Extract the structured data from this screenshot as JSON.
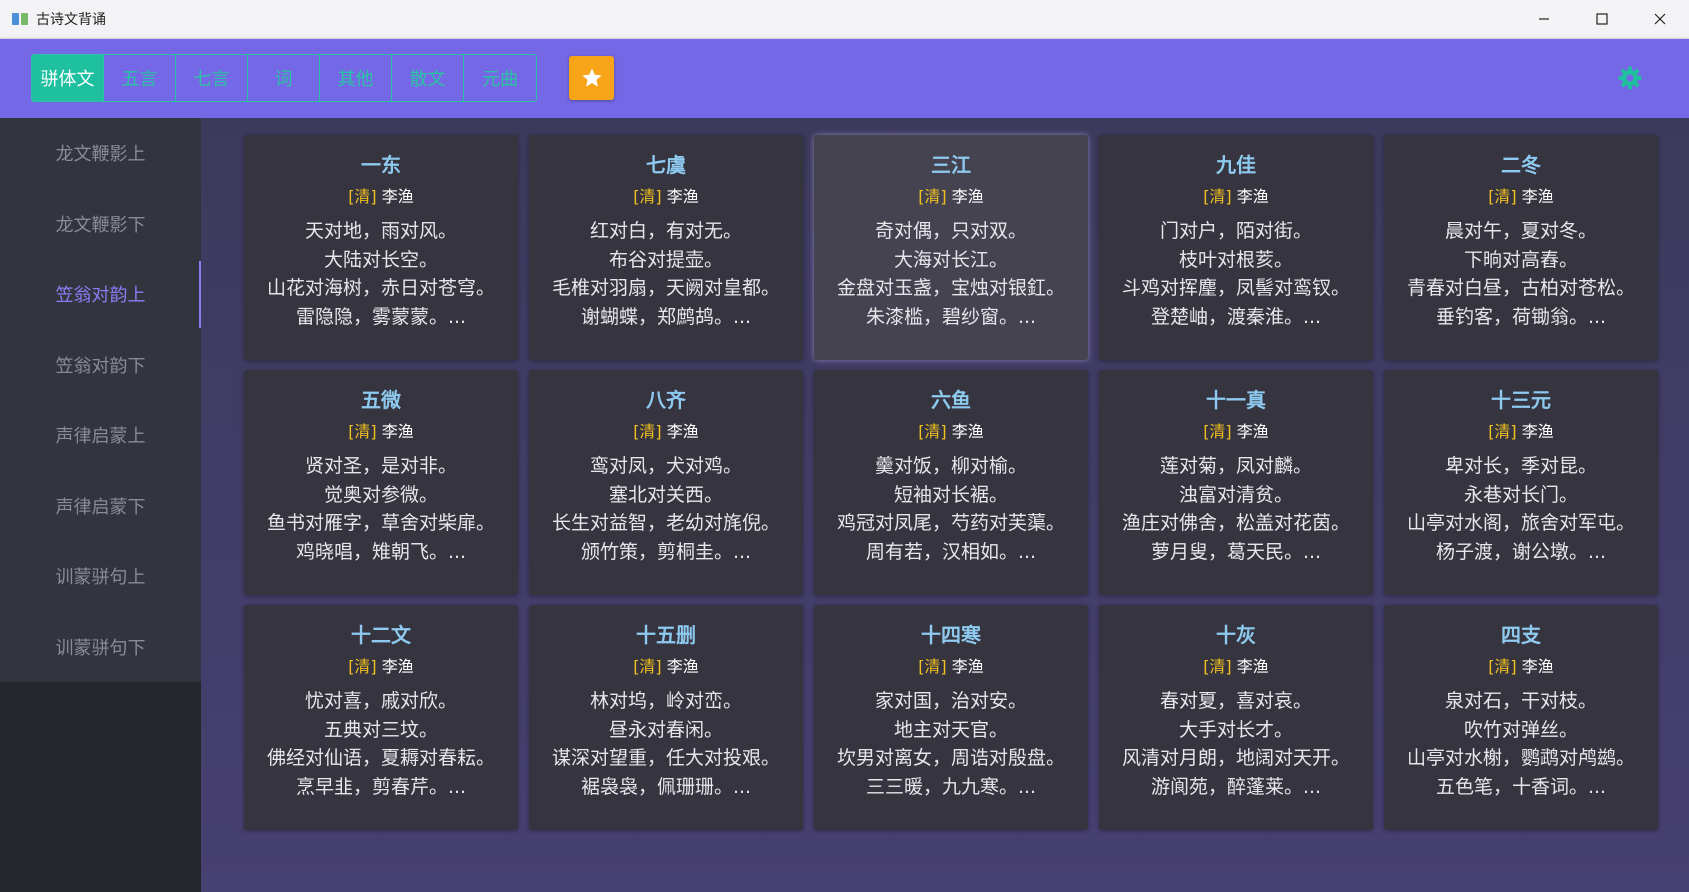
{
  "window": {
    "title": "古诗文背诵",
    "icon": "book-icon"
  },
  "header": {
    "tabs": [
      {
        "label": "骈体文",
        "active": true
      },
      {
        "label": "五言",
        "active": false
      },
      {
        "label": "七言",
        "active": false
      },
      {
        "label": "词",
        "active": false
      },
      {
        "label": "其他",
        "active": false
      },
      {
        "label": "散文",
        "active": false
      },
      {
        "label": "元曲",
        "active": false
      }
    ],
    "favorites_icon": "star-icon",
    "settings_icon": "gear-icon",
    "colors": {
      "bar": "#7468e6",
      "accent": "#1fc09f",
      "favorite": "#f8a419"
    }
  },
  "sidebar": {
    "items": [
      {
        "label": "龙文鞭影上",
        "active": false
      },
      {
        "label": "龙文鞭影下",
        "active": false
      },
      {
        "label": "笠翁对韵上",
        "active": true
      },
      {
        "label": "笠翁对韵下",
        "active": false
      },
      {
        "label": "声律启蒙上",
        "active": false
      },
      {
        "label": "声律启蒙下",
        "active": false
      },
      {
        "label": "训蒙骈句上",
        "active": false
      },
      {
        "label": "训蒙骈句下",
        "active": false
      }
    ]
  },
  "cards": [
    {
      "title": "一东",
      "dynasty": "[清]",
      "author": "李渔",
      "lines": [
        "天对地，雨对风。",
        "大陆对长空。",
        "山花对海树，赤日对苍穹。",
        "雷隐隐，雾蒙蒙。..."
      ]
    },
    {
      "title": "七虞",
      "dynasty": "[清]",
      "author": "李渔",
      "lines": [
        "红对白，有对无。",
        "布谷对提壶。",
        "毛椎对羽扇，天阙对皇都。",
        "谢蝴蝶，郑鹧鸪。..."
      ]
    },
    {
      "title": "三江",
      "dynasty": "[清]",
      "author": "李渔",
      "lines": [
        "奇对偶，只对双。",
        "大海对长江。",
        "金盘对玉盏，宝烛对银釭。",
        "朱漆槛，碧纱窗。..."
      ]
    },
    {
      "title": "九佳",
      "dynasty": "[清]",
      "author": "李渔",
      "lines": [
        "门对户，陌对街。",
        "枝叶对根荄。",
        "斗鸡对挥麈，凤髻对鸾钗。",
        "登楚岫，渡秦淮。..."
      ]
    },
    {
      "title": "二冬",
      "dynasty": "[清]",
      "author": "李渔",
      "lines": [
        "晨对午，夏对冬。",
        "下晌对高舂。",
        "青春对白昼，古柏对苍松。",
        "垂钓客，荷锄翁。..."
      ]
    },
    {
      "title": "五微",
      "dynasty": "[清]",
      "author": "李渔",
      "lines": [
        "贤对圣，是对非。",
        "觉奥对参微。",
        "鱼书对雁字，草舍对柴扉。",
        "鸡晓唱，雉朝飞。..."
      ]
    },
    {
      "title": "八齐",
      "dynasty": "[清]",
      "author": "李渔",
      "lines": [
        "鸾对凤，犬对鸡。",
        "塞北对关西。",
        "长生对益智，老幼对旄倪。",
        "颁竹策，剪桐圭。..."
      ]
    },
    {
      "title": "六鱼",
      "dynasty": "[清]",
      "author": "李渔",
      "lines": [
        "羹对饭，柳对榆。",
        "短袖对长裾。",
        "鸡冠对凤尾，芍药对芙蕖。",
        "周有若，汉相如。..."
      ]
    },
    {
      "title": "十一真",
      "dynasty": "[清]",
      "author": "李渔",
      "lines": [
        "莲对菊，凤对麟。",
        "浊富对清贫。",
        "渔庄对佛舍，松盖对花茵。",
        "萝月叟，葛天民。..."
      ]
    },
    {
      "title": "十三元",
      "dynasty": "[清]",
      "author": "李渔",
      "lines": [
        "卑对长，季对昆。",
        "永巷对长门。",
        "山亭对水阁，旅舍对军屯。",
        "杨子渡，谢公墩。..."
      ]
    },
    {
      "title": "十二文",
      "dynasty": "[清]",
      "author": "李渔",
      "lines": [
        "忧对喜，戚对欣。",
        "五典对三坟。",
        "佛经对仙语，夏耨对春耘。",
        "烹早韭，剪春芹。..."
      ]
    },
    {
      "title": "十五删",
      "dynasty": "[清]",
      "author": "李渔",
      "lines": [
        "林对坞，岭对峦。",
        "昼永对春闲。",
        "谋深对望重，任大对投艰。",
        "裾袅袅，佩珊珊。..."
      ]
    },
    {
      "title": "十四寒",
      "dynasty": "[清]",
      "author": "李渔",
      "lines": [
        "家对国，治对安。",
        "地主对天官。",
        "坎男对离女，周诰对殷盘。",
        "三三暖，九九寒。..."
      ]
    },
    {
      "title": "十灰",
      "dynasty": "[清]",
      "author": "李渔",
      "lines": [
        "春对夏，喜对哀。",
        "大手对长才。",
        "风清对月朗，地阔对天开。",
        "游阆苑，醉蓬莱。..."
      ]
    },
    {
      "title": "四支",
      "dynasty": "[清]",
      "author": "李渔",
      "lines": [
        "泉对石，干对枝。",
        "吹竹对弹丝。",
        "山亭对水榭，鹦鹉对鸬鹚。",
        "五色笔，十香词。..."
      ]
    }
  ]
}
